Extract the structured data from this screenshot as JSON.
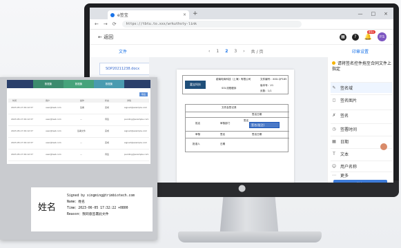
{
  "browser": {
    "tab_title": "e签宝",
    "tab_close": "×",
    "new_tab": "+",
    "window_controls": [
      "—",
      "□",
      "×"
    ],
    "nav": [
      "←",
      "→",
      "⟳"
    ],
    "url": "https://tbtu.to.xxx/wrkuthsty-link"
  },
  "app": {
    "back_label": "← 返回",
    "badge": "99+",
    "avatar_initials": "P.S"
  },
  "toolbar": {
    "left_label": "文件",
    "pages": [
      "‹",
      "1",
      "2",
      "3",
      "›"
    ],
    "current_page": "2",
    "total_label": "共 / 页",
    "right_label": "印章设置"
  },
  "left_panel": {
    "file_chip": "SOP20211238.docx"
  },
  "document": {
    "logo_text": "嘉宝科技",
    "header_cells": [
      "越南电商科技（上海）有限公司",
      "文件编号：XXX-QP185",
      "SOL流程程序",
      "版本号：V1",
      "页数：1/1"
    ],
    "body_title": "文件会签记录",
    "body_cells": [
      "姓名",
      "审核部门",
      "签名日期",
      "审核",
      "签名",
      "签名日期",
      "批准人",
      "日期"
    ],
    "selected_cell": "签名(批注)",
    "signer_hint": "签名"
  },
  "right_panel": {
    "title": "请将签名控件拖至合同文件上",
    "title_sub": "指定",
    "items": [
      {
        "icon": "pen-icon",
        "glyph": "✎",
        "label": "签名域"
      },
      {
        "icon": "stamp-icon",
        "glyph": "◻",
        "label": "签名图片"
      },
      {
        "icon": "signature-icon",
        "glyph": "✗",
        "label": "签名"
      },
      {
        "icon": "clock-icon",
        "glyph": "◷",
        "label": "签署时间"
      },
      {
        "icon": "calendar-icon",
        "glyph": "▦",
        "label": "日期"
      },
      {
        "icon": "text-icon",
        "glyph": "T",
        "label": "文本"
      },
      {
        "icon": "user-icon",
        "glyph": "☺",
        "label": "用户名称"
      },
      {
        "icon": "more-icon",
        "glyph": "⋯",
        "label": "更多"
      }
    ],
    "submit_button": "发起"
  },
  "sheet": {
    "tabs": [
      "数据集",
      "数据集",
      "数据集",
      "数据集"
    ],
    "action_button": "导出",
    "columns": [
      "时间",
      "用户",
      "操作",
      "状态",
      "详情"
    ],
    "rows": [
      [
        "2023-05-17 09:12:37",
        "user@test.com",
        "签署",
        "完成",
        "signed@example.com"
      ],
      [
        "2023-05-17 09:12:37",
        "user@test.com",
        "—",
        "待签",
        "pending@example.com"
      ],
      [
        "2023-05-17 09:12:37",
        "user@test.com",
        "签署文件",
        "完成",
        "signed@example.com"
      ],
      [
        "2023-05-17 09:12:37",
        "user@test.com",
        "—",
        "完成",
        "signed@example.com"
      ],
      [
        "2023-05-17 09:12:37",
        "user@test.com",
        "—",
        "待签",
        "pending@example.com"
      ]
    ]
  },
  "signature": {
    "name": "姓名",
    "lines": [
      "Signed by xingming@trimbiotech.com",
      "Name：姓名",
      "Time：2023-06-05 17:32:22 +0800",
      "Reason：我同意签署此文件"
    ]
  },
  "colors": {
    "accent": "#1a73e8",
    "submit": "#3d7bd9",
    "sheet_header": "#2a3f6b",
    "selection": "#4a79c7"
  }
}
